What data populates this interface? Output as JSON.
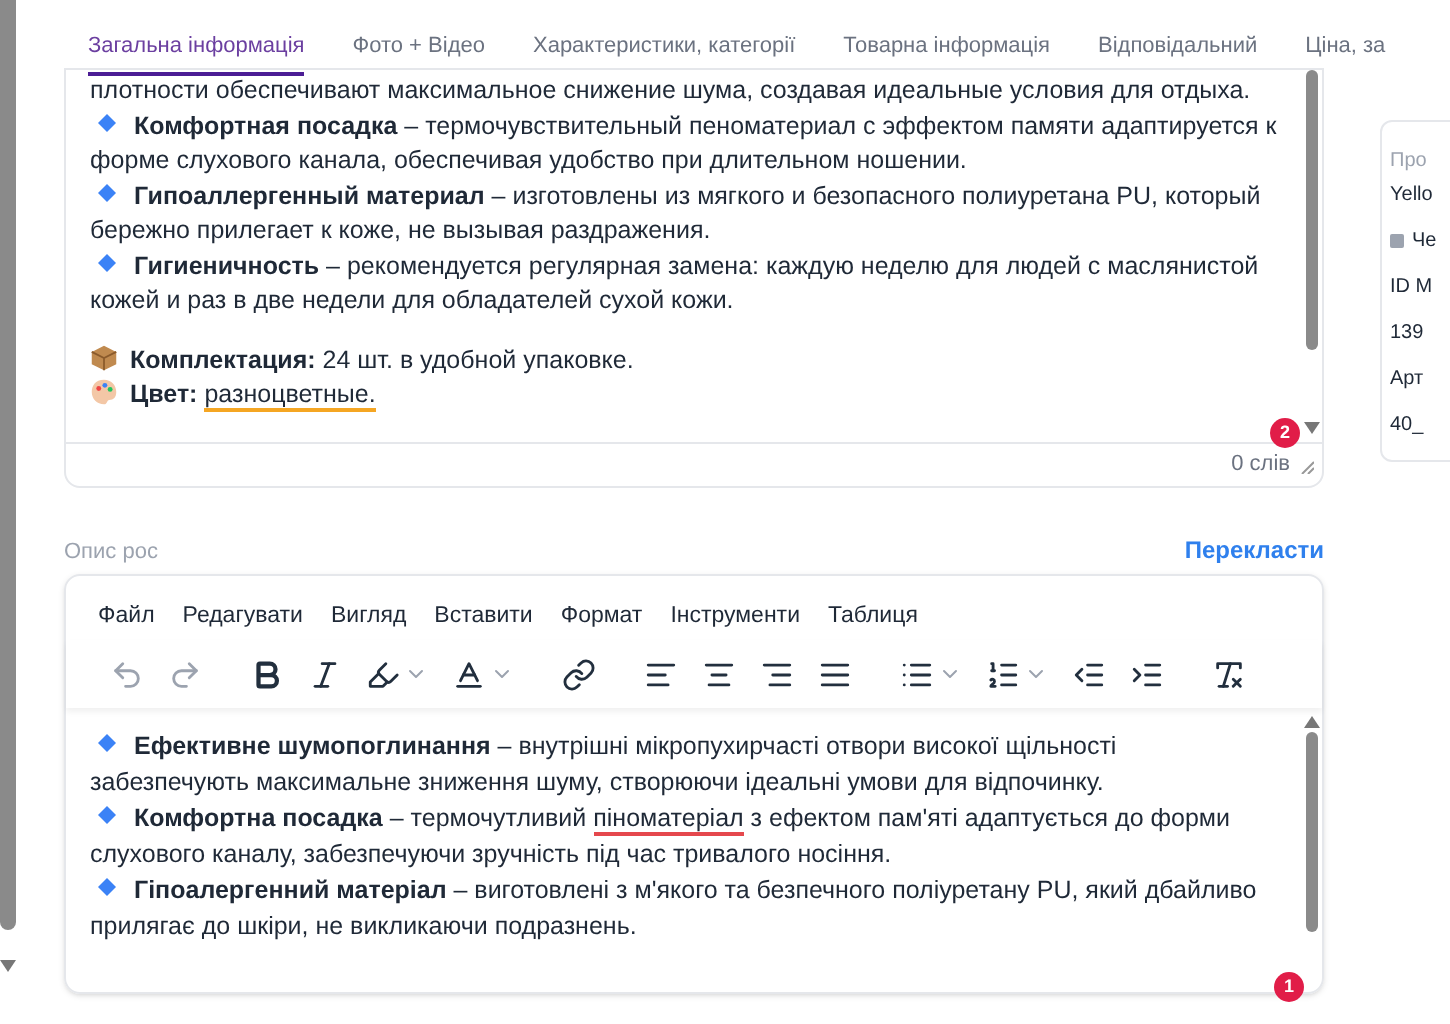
{
  "tabs": [
    {
      "label": "Загальна інформація",
      "selected": true
    },
    {
      "label": "Фото + Відео",
      "selected": false
    },
    {
      "label": "Характеристики, категорії",
      "selected": false
    },
    {
      "label": "Товарна інформація",
      "selected": false
    },
    {
      "label": "Відповідальний",
      "selected": false
    },
    {
      "label": "Ціна, за",
      "selected": false
    }
  ],
  "top_editor": {
    "paragraphs": [
      {
        "kind": "plain",
        "parts": [
          {
            "text": "плотности обеспечивают максимальное снижение шума, создавая идеальные условия для отдыха."
          }
        ]
      },
      {
        "kind": "bullet",
        "parts": [
          {
            "text": "**Комфортная посадка** – термочувствительный пеноматериал с эффектом памяти адаптируется к форме слухового канала, обеспечивая удобство при длительном ношении."
          }
        ]
      },
      {
        "kind": "bullet",
        "parts": [
          {
            "text": "**Гипоаллергенный материал** – изготовлены из мягкого и безопасного полиуретана PU, который бережно прилегает к коже, не вызывая раздражения."
          }
        ]
      },
      {
        "kind": "bullet",
        "parts": [
          {
            "text": "**Гигиеничность** – рекомендуется регулярная замена: каждую неделю для людей с маслянистой кожей и раз в две недели для обладателей сухой кожи."
          }
        ]
      },
      {
        "kind": "box",
        "parts": [
          {
            "text": "**Комплектация:** 24 шт. в удобной упаковке."
          }
        ]
      },
      {
        "kind": "palette",
        "parts": [
          {
            "text": "**Цвет:** "
          },
          {
            "text": "разноцветные.",
            "color": "#f5a623"
          }
        ]
      }
    ],
    "badge": "2",
    "word_count": "0 слів"
  },
  "field_label": "Опис рос",
  "translate_link": "Перекласти",
  "menu": [
    "Файл",
    "Редагувати",
    "Вигляд",
    "Вставити",
    "Формат",
    "Інструменти",
    "Таблиця"
  ],
  "toolbar": [
    {
      "kind": "undo",
      "disabled": true
    },
    {
      "kind": "redo",
      "disabled": true
    },
    {
      "kind": "bold",
      "disabled": false
    },
    {
      "kind": "italic",
      "disabled": false
    },
    {
      "kind": "highlight",
      "disabled": false
    },
    {
      "kind": "textcolor",
      "disabled": false
    },
    {
      "kind": "link",
      "disabled": false
    },
    {
      "kind": "alignleft",
      "disabled": false
    },
    {
      "kind": "aligncenter",
      "disabled": false
    },
    {
      "kind": "alignright",
      "disabled": false
    },
    {
      "kind": "justify",
      "disabled": false
    },
    {
      "kind": "bullist",
      "disabled": false
    },
    {
      "kind": "numlist",
      "disabled": false
    },
    {
      "kind": "outdent",
      "disabled": false
    },
    {
      "kind": "indent",
      "disabled": false
    },
    {
      "kind": "clear",
      "disabled": false
    }
  ],
  "bottom_editor": {
    "paragraphs": [
      {
        "kind": "bullet",
        "parts": [
          {
            "text": "**Ефективне шумопоглинання** – внутрішні мікропухирчасті отвори високої щільності забезпечують максимальне зниження шуму, створюючи ідеальні умови для відпочинку."
          }
        ]
      },
      {
        "kind": "bullet",
        "parts": [
          {
            "text": "**Комфортна посадка** – термочутливий "
          },
          {
            "text": "піноматеріал",
            "color": "#e5484d"
          },
          {
            "text": " з ефектом пам'яті адаптується до форми слухового каналу, забезпечуючи зручність під час тривалого носіння."
          }
        ]
      },
      {
        "kind": "bullet",
        "parts": [
          {
            "text": "**Гіпоалергенний матеріал** – виготовлені з м'якого та безпечного поліуретану PU, який дбайливо прилягає до шкіри, не викликаючи подразнень."
          }
        ]
      }
    ],
    "badge": "1"
  },
  "side_card": {
    "lines": [
      {
        "text": "Про",
        "kind": "label"
      },
      {
        "text": "Yello",
        "kind": "value"
      },
      {
        "text": "Че",
        "kind": "status"
      },
      {
        "text": "ID M",
        "kind": "value"
      },
      {
        "text": "139",
        "kind": "value"
      },
      {
        "text": "Арт",
        "kind": "value"
      },
      {
        "text": "40_",
        "kind": "value"
      }
    ]
  }
}
